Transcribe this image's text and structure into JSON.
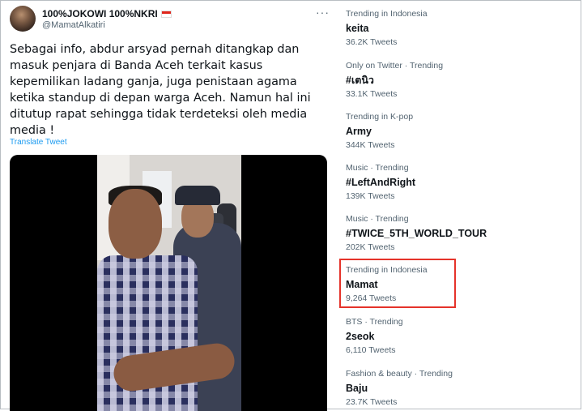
{
  "tweet": {
    "author_name": "100%JOKOWI 100%NKRI",
    "author_handle": "@MamatAlkatiri",
    "more_icon": "more-horizontal-icon",
    "text": "Sebagai info, abdur arsyad pernah ditangkap dan masuk penjara di Banda Aceh terkait kasus kepemilikan ladang ganja, juga penistaan agama ketika standup di depan warga Aceh. Namun hal ini ditutup rapat sehingga tidak terdeteksi oleh media media !",
    "translate_label": "Translate Tweet",
    "flag": {
      "top": "#e0261b",
      "bottom": "#ffffff"
    }
  },
  "trends": [
    {
      "context": "Trending in Indonesia",
      "name": "keita",
      "count": "36.2K Tweets"
    },
    {
      "context": "Only on Twitter · Trending",
      "name": "#เตนิว",
      "count": "33.1K Tweets"
    },
    {
      "context": "Trending in K-pop",
      "name": "Army",
      "count": "344K Tweets"
    },
    {
      "context": "Music · Trending",
      "name": "#LeftAndRight",
      "count": "139K Tweets"
    },
    {
      "context": "Music · Trending",
      "name": "#TWICE_5TH_WORLD_TOUR",
      "count": "202K Tweets"
    },
    {
      "context": "Trending in Indonesia",
      "name": "Mamat",
      "count": "9,264 Tweets"
    },
    {
      "context": "BTS · Trending",
      "name": "2seok",
      "count": "6,110 Tweets"
    },
    {
      "context": "Fashion & beauty · Trending",
      "name": "Baju",
      "count": "23.7K Tweets"
    }
  ],
  "colors": {
    "accent_link": "#1d9bf0",
    "highlight_border": "#e5332a",
    "secondary_text": "#536471"
  }
}
